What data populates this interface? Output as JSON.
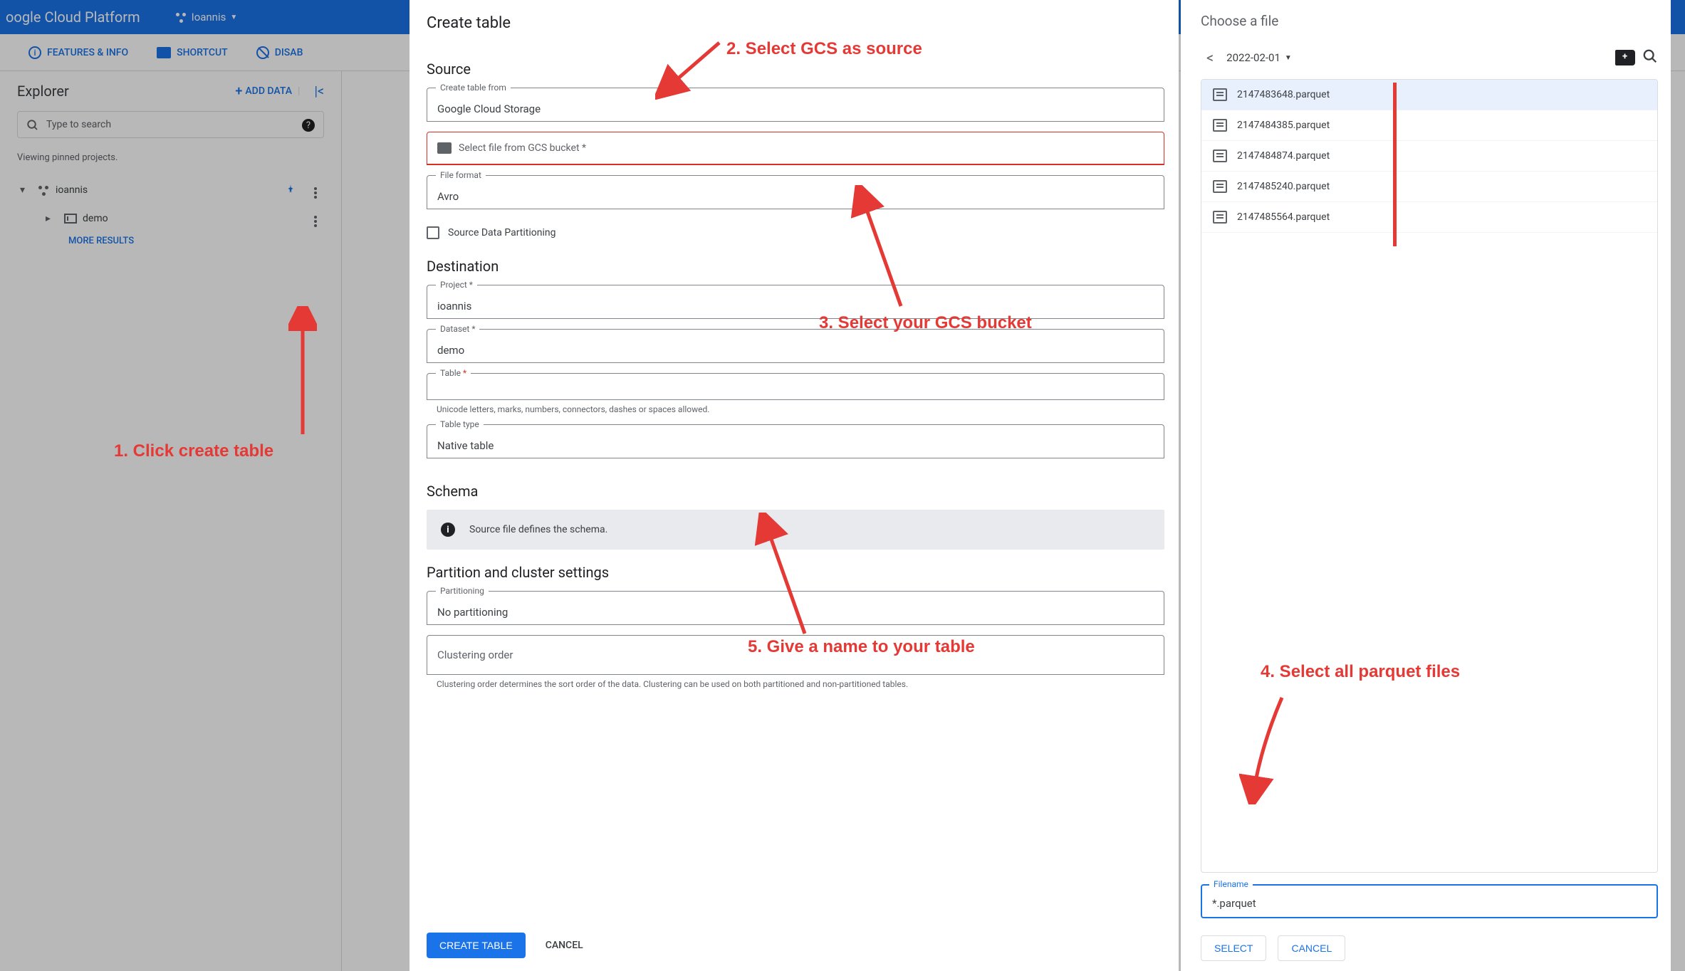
{
  "topbar": {
    "platform": "oogle Cloud Platform",
    "project": "Ioannis"
  },
  "actionbar": {
    "features": "FEATURES & INFO",
    "shortcut": "SHORTCUT",
    "disable": "DISAB"
  },
  "explorer": {
    "title": "Explorer",
    "add_data": "ADD DATA",
    "search_placeholder": "Type to search",
    "pinned_msg": "Viewing pinned projects.",
    "project_name": "ioannis",
    "dataset_name": "demo",
    "more_results": "MORE RESULTS"
  },
  "create": {
    "title": "Create table",
    "source_heading": "Source",
    "create_from_label": "Create table from",
    "create_from_value": "Google Cloud Storage",
    "gcs_placeholder": "Select file from GCS bucket *",
    "file_format_label": "File format",
    "file_format_value": "Avro",
    "partitioning_cb": "Source Data Partitioning",
    "dest_heading": "Destination",
    "project_label": "Project *",
    "project_value": "ioannis",
    "dataset_label": "Dataset *",
    "dataset_value": "demo",
    "table_label": "Table",
    "table_helper": "Unicode letters, marks, numbers, connectors, dashes or spaces allowed.",
    "table_type_label": "Table type",
    "table_type_value": "Native table",
    "schema_heading": "Schema",
    "schema_info": "Source file defines the schema.",
    "pcs_heading": "Partition and cluster settings",
    "partitioning_label": "Partitioning",
    "partitioning_value": "No partitioning",
    "cluster_label": "Clustering order",
    "cluster_helper": "Clustering order determines the sort order of the data. Clustering can be used on both partitioned and non-partitioned tables.",
    "create_btn": "CREATE TABLE",
    "cancel_btn": "CANCEL"
  },
  "filepanel": {
    "title": "Choose a file",
    "breadcrumb": "2022-02-01",
    "files": [
      "2147483648.parquet",
      "2147484385.parquet",
      "2147484874.parquet",
      "2147485240.parquet",
      "2147485564.parquet"
    ],
    "filename_label": "Filename",
    "filename_value": "*.parquet",
    "select_btn": "SELECT",
    "cancel_btn": "CANCEL"
  },
  "annotations": {
    "a1": "1. Click create table",
    "a2": "2. Select GCS as source",
    "a3": "3. Select your GCS bucket",
    "a4": "4. Select all parquet files",
    "a5": "5. Give a name to your table"
  }
}
